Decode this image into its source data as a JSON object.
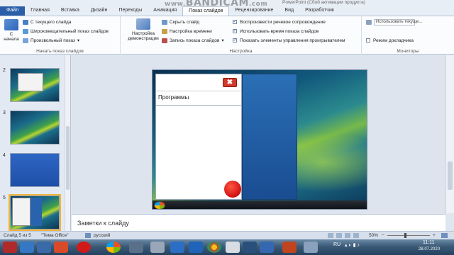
{
  "window": {
    "watermark": "BANDICAM",
    "watermark_suffix": ".com",
    "watermark_prefix": "www.",
    "title_suffix": "PowerPoint (Сбой активации продукта)"
  },
  "tabs": [
    {
      "label": "Файл"
    },
    {
      "label": "Главная"
    },
    {
      "label": "Вставка"
    },
    {
      "label": "Дизайн"
    },
    {
      "label": "Переходы"
    },
    {
      "label": "Анимация"
    },
    {
      "label": "Показ слайдов"
    },
    {
      "label": "Рецензирование"
    },
    {
      "label": "Вид"
    },
    {
      "label": "Разработчик"
    }
  ],
  "ribbon": {
    "start_group": {
      "big_button": "С начала",
      "items": [
        "С текущего слайда",
        "Широковещательный показ слайдов",
        "Произвольный показ"
      ],
      "label": "Начать показ слайдов"
    },
    "setup_group": {
      "big_button": "Настройка демонстрации",
      "items": [
        "Скрыть слайд",
        "Настройка времени",
        "Запись показа слайдов"
      ],
      "checks": [
        {
          "label": "Воспроизвести речевое сопровождение",
          "checked": true
        },
        {
          "label": "Использовать время показа слайдов",
          "checked": true
        },
        {
          "label": "Показать элементы управления проигрывателем",
          "checked": true
        }
      ],
      "label": "Настройка"
    },
    "monitors_group": {
      "dropdown": "Использовать текуще...",
      "presenter": "Режим докладчика",
      "label": "Мониторы"
    }
  },
  "slides_panel": {
    "numbers": [
      "2",
      "3",
      "4",
      "5"
    ],
    "selected": "5"
  },
  "slide": {
    "menu_label": "Программы",
    "close_glyph": "✖"
  },
  "notes": {
    "placeholder": "Заметки к слайду"
  },
  "status_bar": {
    "slide_info": "Слайд 5 из 5",
    "theme": "\"Тема Office\"",
    "language": "русский",
    "zoom": "50%"
  },
  "taskbar": {
    "lang": "RU",
    "time": "11:11",
    "date": "28.07.2020"
  },
  "colors": {
    "file_tab": "#2a5ea8",
    "close_button": "#d33a2c",
    "selection": "#f2b43a"
  }
}
